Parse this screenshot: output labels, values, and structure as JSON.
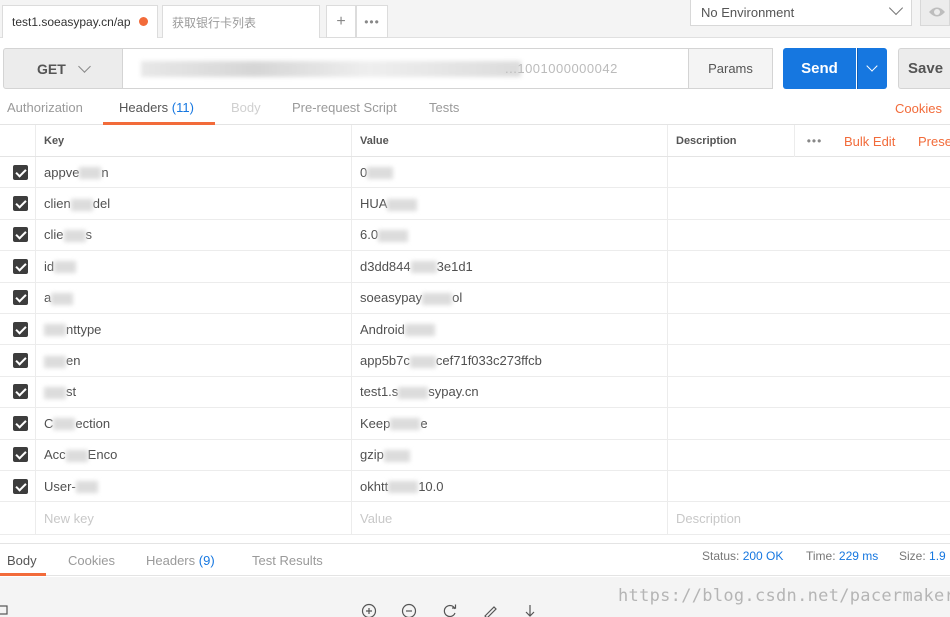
{
  "tabs": {
    "active_label": "test1.soeasypay.cn/ap",
    "ghost_label": "获取银行卡列表",
    "plus": "+",
    "more": "•••"
  },
  "environment": {
    "selected": "No Environment"
  },
  "request": {
    "method": "GET",
    "url_visible": "...1001000000042",
    "params_label": "Params",
    "send_label": "Send",
    "save_label": "Save"
  },
  "request_tabs": {
    "authorization": "Authorization",
    "headers": "Headers",
    "headers_count": "(11)",
    "body": "Body",
    "prerequest": "Pre-request Script",
    "tests": "Tests",
    "cookies": "Cookies"
  },
  "headers_table": {
    "col_key": "Key",
    "col_value": "Value",
    "col_description": "Description",
    "more": "•••",
    "bulk_edit": "Bulk Edit",
    "presets": "Prese",
    "rows": [
      {
        "key": "appve",
        "key_tail": "n",
        "value": "0",
        "value_tail": ""
      },
      {
        "key": "clien",
        "key_tail": "del",
        "value": "HUA",
        "value_tail": ""
      },
      {
        "key": "clie",
        "key_tail": "s",
        "value": "6.0",
        "value_tail": ""
      },
      {
        "key": "id",
        "key_tail": "",
        "value": "d3dd844",
        "value_tail": "3e1d1"
      },
      {
        "key": "a",
        "key_tail": "",
        "value": "soeasypay",
        "value_tail": "ol"
      },
      {
        "key": "",
        "key_tail": "nttype",
        "value": "Android",
        "value_tail": ""
      },
      {
        "key": "",
        "key_tail": "en",
        "value": "app5b7c",
        "value_tail": "cef71f033c273ffcb"
      },
      {
        "key": "",
        "key_tail": "st",
        "value": "test1.s",
        "value_tail": "sypay.cn"
      },
      {
        "key": "C",
        "key_tail": "ection",
        "value": "Keep",
        "value_tail": "e"
      },
      {
        "key": "Acc",
        "key_tail": "Enco",
        "value": "gzip",
        "value_tail": ""
      },
      {
        "key": "User-",
        "key_tail": "",
        "value": "okhtt",
        "value_tail": "10.0"
      }
    ],
    "new_key_placeholder": "New key",
    "value_placeholder": "Value",
    "description_placeholder": "Description"
  },
  "response": {
    "body": "Body",
    "cookies": "Cookies",
    "headers": "Headers",
    "headers_count": "(9)",
    "test_results": "Test Results",
    "status_label": "Status:",
    "status_value": "200 OK",
    "time_label": "Time:",
    "time_value": "229 ms",
    "size_label": "Size:",
    "size_value": "1.9"
  },
  "watermark": "https://blog.csdn.net/pacermaker",
  "colors": {
    "accent": "#f26b3a",
    "primary": "#1677e0"
  }
}
